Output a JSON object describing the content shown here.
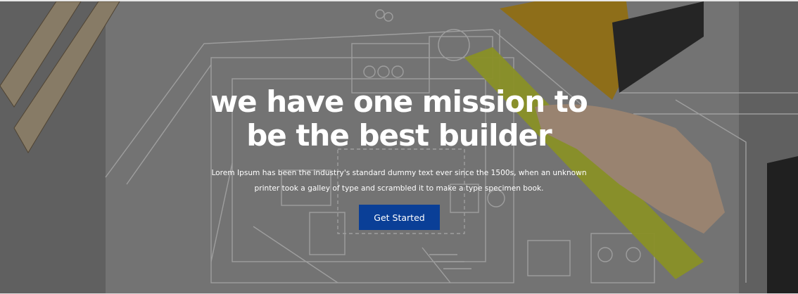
{
  "hero": {
    "title_line1": "we have one mission to",
    "title_line2": "be the best builder",
    "description_line1": "Lorem Ipsum has been the industry's standard dummy text ever since the 1500s, when an unknown",
    "description_line2": "printer took a galley of type and scrambled it to make a type specimen book.",
    "cta_label": "Get Started"
  },
  "colors": {
    "overlay": "#3c3c3c",
    "button_bg": "#0a3f97",
    "text": "#ffffff",
    "ruler_yellow": "#c9d32a",
    "ruler_orange": "#d8a21a"
  },
  "background": {
    "subject": "architectural-blueprint-with-rulers-and-hand",
    "icons": [
      "blueprint-illustration",
      "ruler-illustration",
      "pencil-illustration",
      "hand-illustration"
    ]
  }
}
